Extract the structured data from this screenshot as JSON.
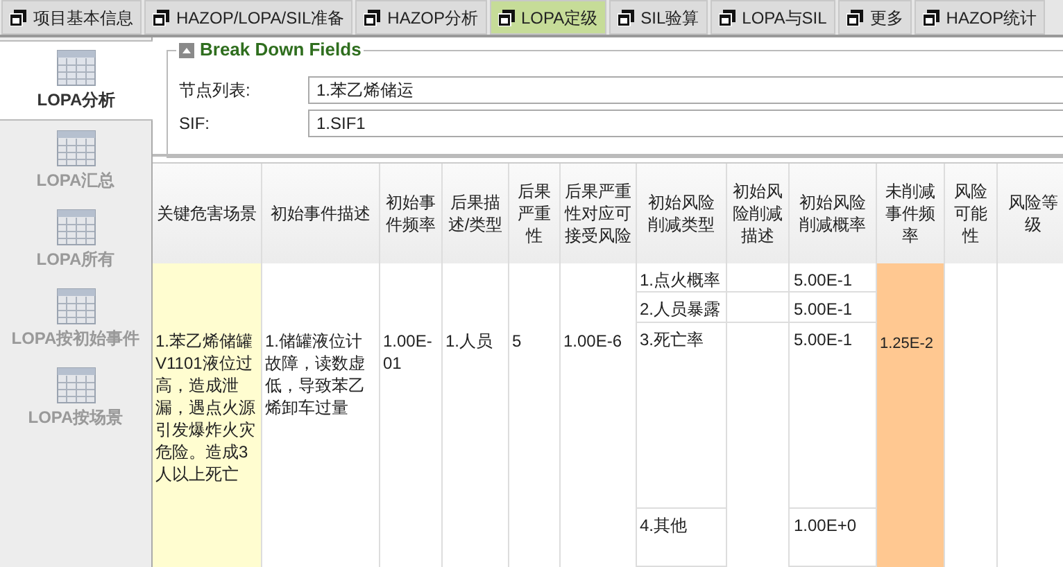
{
  "tabs": [
    {
      "label": "项目基本信息",
      "selected": false
    },
    {
      "label": "HAZOP/LOPA/SIL准备",
      "selected": false
    },
    {
      "label": "HAZOP分析",
      "selected": false
    },
    {
      "label": "LOPA定级",
      "selected": true
    },
    {
      "label": "SIL验算",
      "selected": false
    },
    {
      "label": "LOPA与SIL",
      "selected": false
    },
    {
      "label": "更多",
      "selected": false
    },
    {
      "label": "HAZOP统计",
      "selected": false
    }
  ],
  "sidebar": {
    "items": [
      {
        "label": "LOPA分析",
        "selected": true
      },
      {
        "label": "LOPA汇总",
        "selected": false
      },
      {
        "label": "LOPA所有",
        "selected": false
      },
      {
        "label": "LOPA按初始事件",
        "selected": false
      },
      {
        "label": "LOPA按场景",
        "selected": false
      }
    ]
  },
  "breakdown": {
    "title": "Break Down Fields",
    "fields": [
      {
        "label": "节点列表:",
        "value": "1.苯乙烯储运"
      },
      {
        "label": "SIF:",
        "value": "1.SIF1"
      }
    ]
  },
  "table": {
    "columns": [
      "关键危害场景",
      "初始事件描述",
      "初始事件频率",
      "后果描述/类型",
      "后果严重性",
      "后果严重性对应可接受风险",
      "初始风险削减类型",
      "初始风险削减描述",
      "初始风险削减概率",
      "未削减事件频率",
      "风险可能性",
      "风险等级"
    ],
    "row": {
      "scenario": "1.苯乙烯储罐V1101液位过高，造成泄漏，遇点火源引发爆炸火灾危险。造成3人以上死亡",
      "event": "1.储罐液位计故障，读数虚低，导致苯乙烯卸车过量",
      "frequency": "1.00E-01",
      "consequence": "1.人员",
      "severity": "5",
      "acceptable_risk": "1.00E-6",
      "reductions": [
        {
          "type": "1.点火概率",
          "probability": "5.00E-1"
        },
        {
          "type": "2.人员暴露",
          "probability": "5.00E-1"
        },
        {
          "type": "3.死亡率",
          "probability": "5.00E-1"
        },
        {
          "type": "4.其他",
          "probability": "1.00E+0"
        }
      ],
      "unmitigated_frequency": "1.25E-2"
    }
  }
}
